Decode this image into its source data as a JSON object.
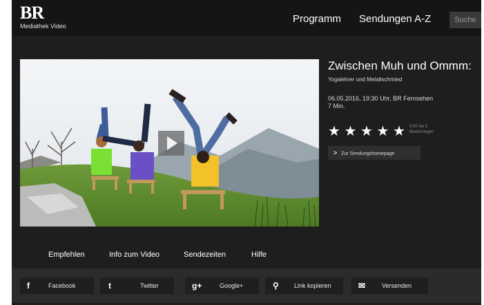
{
  "header": {
    "logo": "BR",
    "logo_sub": "Mediathek Video",
    "nav": [
      "Programm",
      "Sendungen A-Z"
    ],
    "search_label": "Suche"
  },
  "video": {
    "title": "Zwischen Muh und Ommm:",
    "subtitle": "Yogalehrer und Metallschmied",
    "date_line": "06.05.2016, 19:30 Uhr, BR Fernsehen",
    "duration": "7 Min.",
    "rating_stars": 5,
    "rating_text_1": "5,00 bei 5",
    "rating_text_2": "Bewertungen",
    "homepage_button": "Zur Sendungshomepage"
  },
  "tabs": [
    "Empfehlen",
    "Info zum Video",
    "Sendezeiten",
    "Hilfe"
  ],
  "share": [
    {
      "icon": "facebook-icon",
      "glyph": "f",
      "label": "Facebook"
    },
    {
      "icon": "twitter-icon",
      "glyph": "t",
      "label": "Twitter"
    },
    {
      "icon": "googleplus-icon",
      "glyph": "g+",
      "label": "Google+"
    },
    {
      "icon": "link-icon",
      "glyph": "⚲",
      "label": "Link kopieren"
    },
    {
      "icon": "mail-icon",
      "glyph": "✉",
      "label": "Versenden"
    }
  ]
}
